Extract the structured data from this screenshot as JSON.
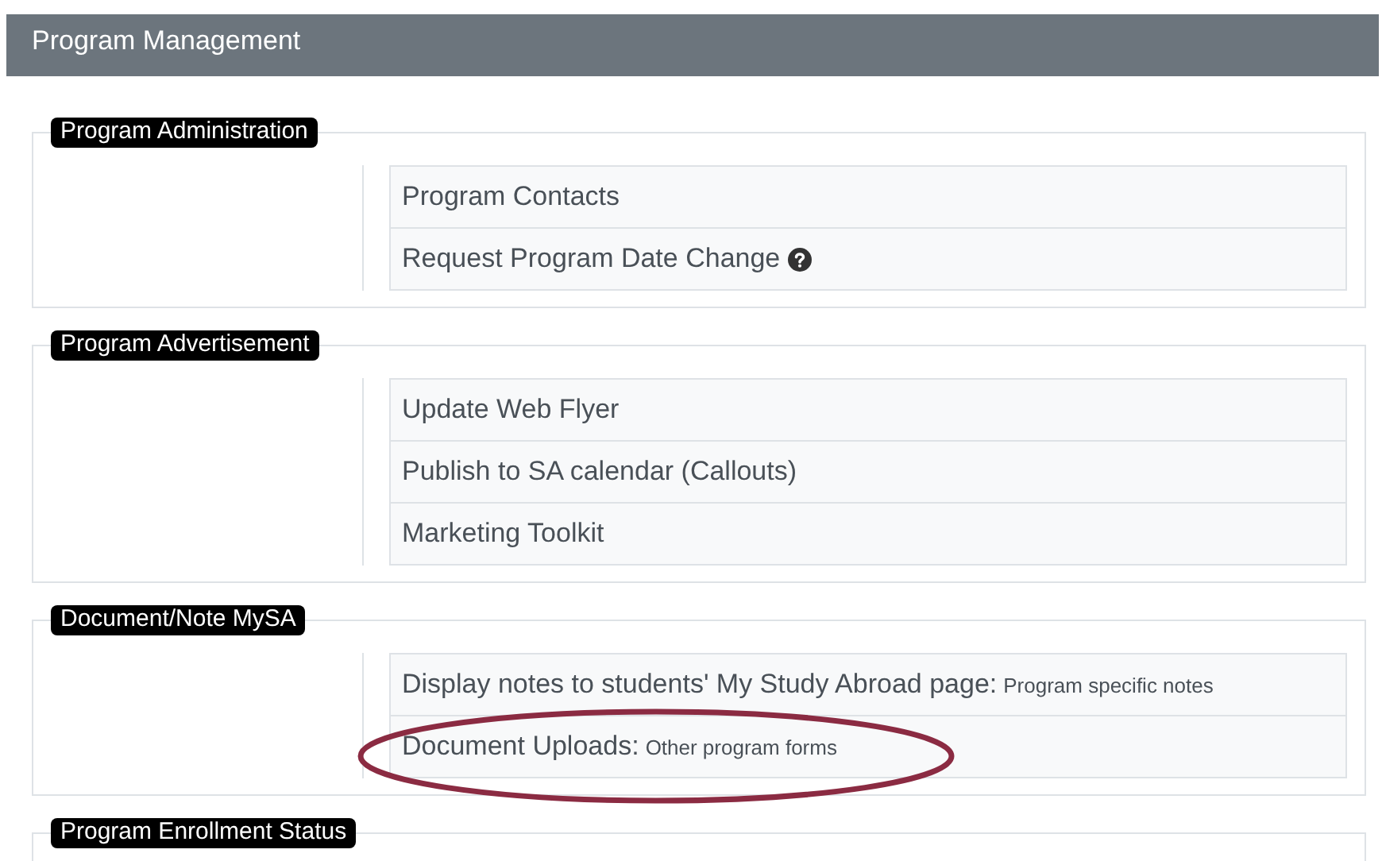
{
  "header": {
    "title": "Program Management"
  },
  "sections": [
    {
      "legend": "Program Administration",
      "items": [
        {
          "label": "Program Contacts",
          "help": false,
          "circled": false
        },
        {
          "label": "Request Program Date Change",
          "help": true,
          "circled": false
        }
      ]
    },
    {
      "legend": "Program Advertisement",
      "items": [
        {
          "label": "Update Web Flyer",
          "help": false,
          "circled": false
        },
        {
          "label": "Publish to SA calendar (Callouts)",
          "help": false,
          "circled": false
        },
        {
          "label": "Marketing Toolkit",
          "help": false,
          "circled": false
        }
      ]
    },
    {
      "legend": "Document/Note MySA",
      "items": [
        {
          "label": "Display notes to students' My Study Abroad page:",
          "note": "Program specific notes",
          "help": false,
          "circled": false
        },
        {
          "label": "Document Uploads:",
          "note": "Other program forms",
          "help": false,
          "circled": true
        }
      ]
    },
    {
      "legend": "Program Enrollment Status"
    }
  ]
}
